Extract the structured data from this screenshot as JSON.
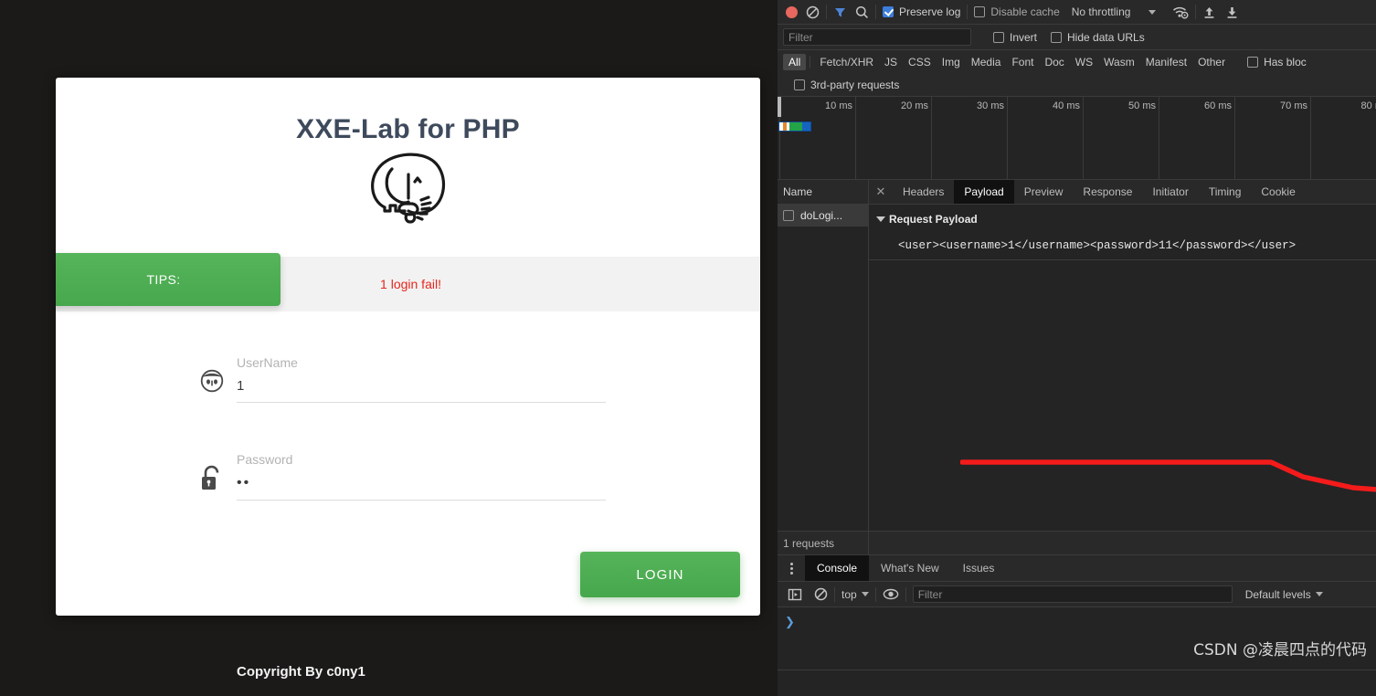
{
  "page": {
    "brand_title": "XXE-Lab for PHP",
    "logo_icon": "php-elephant-icon",
    "tips": {
      "badge_label": "TIPS:",
      "message": "1 login fail!",
      "badge_color": "#4cae4c",
      "message_color": "#e8261c"
    },
    "form": {
      "username": {
        "icon": "user-avatar-icon",
        "label": "UserName",
        "value": "1",
        "placeholder": ""
      },
      "password": {
        "icon": "unlocked-padlock-icon",
        "label": "Password",
        "value": "••",
        "placeholder": ""
      },
      "submit_label": "LOGIN",
      "submit_color": "#4cae4c"
    },
    "copyright": "Copyright By c0ny1"
  },
  "devtools": {
    "network_toolbar": {
      "record_icon": "record-stop-icon",
      "clear_icon": "clear-no-entry-icon",
      "filter_icon": "funnel-filter-icon",
      "search_icon": "search-magnifier-icon",
      "preserve_log": {
        "label": "Preserve log",
        "checked": true
      },
      "disable_cache": {
        "label": "Disable cache",
        "checked": false
      },
      "throttling": "No throttling",
      "throttling_caret": "chevron-down-icon",
      "wifi_icon": "wifi-settings-icon",
      "import_icon": "upload-arrow-icon",
      "export_icon": "download-arrow-icon"
    },
    "filter_toolbar": {
      "filter_placeholder": "Filter",
      "filter_value": "",
      "invert": {
        "label": "Invert",
        "checked": false
      },
      "hide_data_urls": {
        "label": "Hide data URLs",
        "checked": false
      }
    },
    "type_filters": [
      {
        "label": "All",
        "active": true
      },
      {
        "label": "Fetch/XHR",
        "active": false
      },
      {
        "label": "JS",
        "active": false
      },
      {
        "label": "CSS",
        "active": false
      },
      {
        "label": "Img",
        "active": false
      },
      {
        "label": "Media",
        "active": false
      },
      {
        "label": "Font",
        "active": false
      },
      {
        "label": "Doc",
        "active": false
      },
      {
        "label": "WS",
        "active": false
      },
      {
        "label": "Wasm",
        "active": false
      },
      {
        "label": "Manifest",
        "active": false
      },
      {
        "label": "Other",
        "active": false
      }
    ],
    "has_blocked": {
      "label": "Has bloc",
      "checked": false
    },
    "third_party": {
      "label": "3rd-party requests",
      "checked": false
    },
    "overview": {
      "ticks": [
        "10 ms",
        "20 ms",
        "30 ms",
        "40 ms",
        "50 ms",
        "60 ms",
        "70 ms",
        "80 m"
      ],
      "bar_segments": [
        "#ffffff",
        "#e08a2e",
        "#22a447",
        "#1565c0"
      ]
    },
    "request_list": {
      "column_header": "Name",
      "rows": [
        {
          "name": "doLogi...",
          "selected": true
        }
      ]
    },
    "detail": {
      "close_icon": "close-x-icon",
      "tabs": [
        {
          "label": "Headers",
          "active": false
        },
        {
          "label": "Payload",
          "active": true
        },
        {
          "label": "Preview",
          "active": false
        },
        {
          "label": "Response",
          "active": false
        },
        {
          "label": "Initiator",
          "active": false
        },
        {
          "label": "Timing",
          "active": false
        },
        {
          "label": "Cookie",
          "active": false
        }
      ],
      "section_title": "Request Payload",
      "section_expanded": true,
      "payload_text": "<user><username>1</username><password>11</password></user>",
      "annotation": {
        "type": "red-underline-scribble",
        "color": "#f41b1b"
      }
    },
    "request_status": {
      "count_label": "1 requests"
    },
    "drawer": {
      "more_icon": "kebab-menu-icon",
      "tabs": [
        {
          "label": "Console",
          "active": true
        },
        {
          "label": "What's New",
          "active": false
        },
        {
          "label": "Issues",
          "active": false
        }
      ],
      "console_toolbar": {
        "sidebar_icon": "show-console-sidebar-icon",
        "clear_icon": "clear-no-entry-icon",
        "context": "top",
        "context_caret": "chevron-down-icon",
        "eye_icon": "live-expression-eye-icon",
        "filter_placeholder": "Filter",
        "filter_value": "",
        "levels": "Default levels",
        "levels_caret": "chevron-down-icon"
      },
      "prompt_icon": "console-prompt-chevron-icon"
    },
    "watermark": "CSDN @凌晨四点的代码"
  }
}
